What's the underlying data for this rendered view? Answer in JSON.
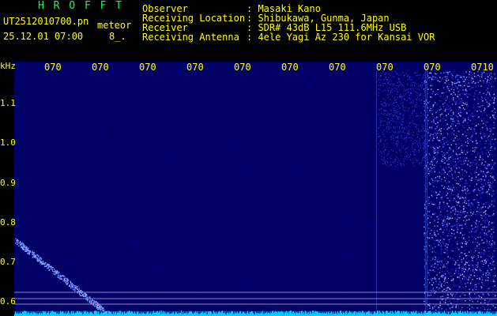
{
  "header": {
    "title": "H R O F F T",
    "filename": "UT2512010700.pn",
    "type": "meteor",
    "datetime": "25.12.01 07:00",
    "extra": "8_.",
    "fields": [
      {
        "label": "Observer",
        "value": ": Masaki Kano"
      },
      {
        "label": "Receiving Location",
        "value": ": Shibukawa, Gunma, Japan"
      },
      {
        "label": "Receiver",
        "value": ": SDR# 43dB L15 111.6MHz USB"
      },
      {
        "label": "Receiving Antenna",
        "value": ": 4ele Yagi Az 230 for Kansai VOR"
      }
    ]
  },
  "plot": {
    "y_unit": "kHz",
    "y_ticks": [
      "1.1",
      "1.0",
      "0.9",
      "0.8",
      "0.7",
      "0.6"
    ],
    "x_ticks": [
      "070",
      "070",
      "070",
      "070",
      "070",
      "070",
      "070",
      "070",
      "070",
      "0710"
    ]
  },
  "colors": {
    "background": "#000000",
    "header_text": "#ffff00",
    "title_text": "#00ff66",
    "spectrum_base": "#000066",
    "signal": "#6688ff",
    "baseline": "#00ccff"
  }
}
